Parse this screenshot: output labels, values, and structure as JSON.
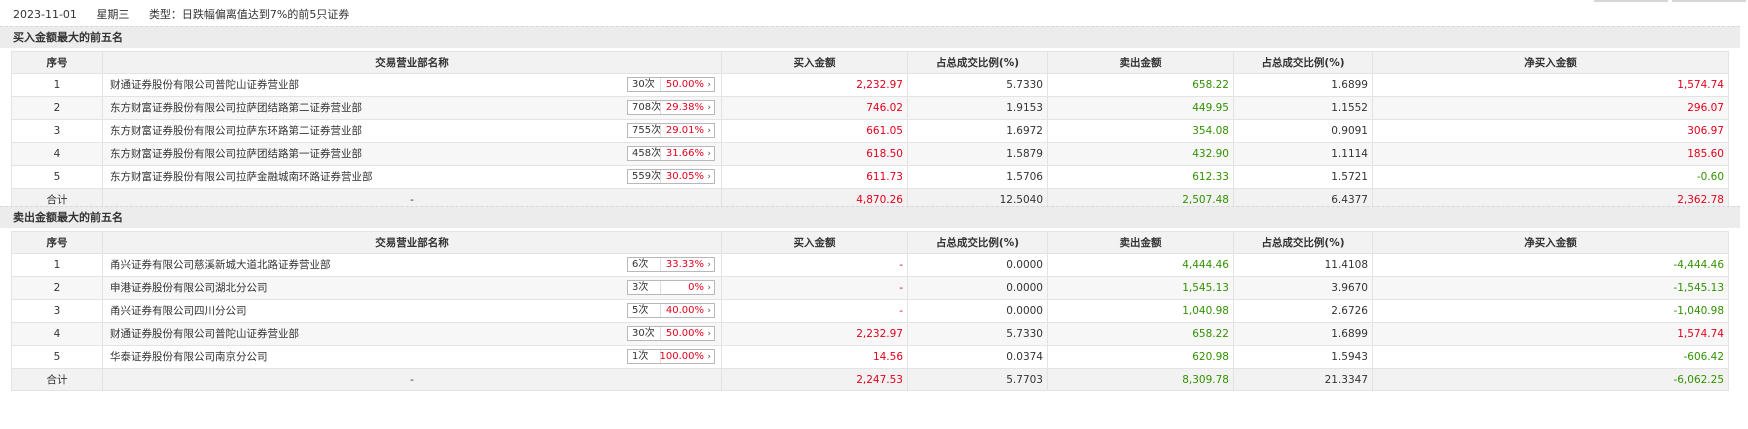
{
  "info": {
    "date": "2023-11-01",
    "weekday": "星期三",
    "type": "类型：日跌幅偏离值达到7%的前5只证券"
  },
  "columns": {
    "rank": "序号",
    "dept": "交易营业部名称",
    "buy": "买入金额",
    "buy_ratio": "占总成交比例(%)",
    "sell": "卖出金额",
    "sell_ratio": "占总成交比例(%)",
    "net": "净买入金额"
  },
  "buy_section": {
    "title": "买入金额最大的前五名",
    "rows": [
      {
        "rank": "1",
        "dept": "财通证券股份有限公司普陀山证券营业部",
        "count": "30次",
        "pct": "50.00%",
        "buy": "2,232.97",
        "buy_ratio": "5.7330",
        "sell": "658.22",
        "sell_ratio": "1.6899",
        "net": "1,574.74"
      },
      {
        "rank": "2",
        "dept": "东方财富证券股份有限公司拉萨团结路第二证券营业部",
        "count": "708次",
        "pct": "29.38%",
        "buy": "746.02",
        "buy_ratio": "1.9153",
        "sell": "449.95",
        "sell_ratio": "1.1552",
        "net": "296.07"
      },
      {
        "rank": "3",
        "dept": "东方财富证券股份有限公司拉萨东环路第二证券营业部",
        "count": "755次",
        "pct": "29.01%",
        "buy": "661.05",
        "buy_ratio": "1.6972",
        "sell": "354.08",
        "sell_ratio": "0.9091",
        "net": "306.97"
      },
      {
        "rank": "4",
        "dept": "东方财富证券股份有限公司拉萨团结路第一证券营业部",
        "count": "458次",
        "pct": "31.66%",
        "buy": "618.50",
        "buy_ratio": "1.5879",
        "sell": "432.90",
        "sell_ratio": "1.1114",
        "net": "185.60"
      },
      {
        "rank": "5",
        "dept": "东方财富证券股份有限公司拉萨金融城南环路证券营业部",
        "count": "559次",
        "pct": "30.05%",
        "buy": "611.73",
        "buy_ratio": "1.5706",
        "sell": "612.33",
        "sell_ratio": "1.5721",
        "net": "-0.60"
      }
    ],
    "total": {
      "label": "合计",
      "dept": "-",
      "buy": "4,870.26",
      "buy_ratio": "12.5040",
      "sell": "2,507.48",
      "sell_ratio": "6.4377",
      "net": "2,362.78"
    }
  },
  "sell_section": {
    "title": "卖出金额最大的前五名",
    "rows": [
      {
        "rank": "1",
        "dept": "甬兴证券有限公司慈溪新城大道北路证券营业部",
        "count": "6次",
        "pct": "33.33%",
        "buy": "-",
        "buy_ratio": "0.0000",
        "sell": "4,444.46",
        "sell_ratio": "11.4108",
        "net": "-4,444.46"
      },
      {
        "rank": "2",
        "dept": "申港证券股份有限公司湖北分公司",
        "count": "3次",
        "pct": "0%",
        "buy": "-",
        "buy_ratio": "0.0000",
        "sell": "1,545.13",
        "sell_ratio": "3.9670",
        "net": "-1,545.13"
      },
      {
        "rank": "3",
        "dept": "甬兴证券有限公司四川分公司",
        "count": "5次",
        "pct": "40.00%",
        "buy": "-",
        "buy_ratio": "0.0000",
        "sell": "1,040.98",
        "sell_ratio": "2.6726",
        "net": "-1,040.98"
      },
      {
        "rank": "4",
        "dept": "财通证券股份有限公司普陀山证券营业部",
        "count": "30次",
        "pct": "50.00%",
        "buy": "2,232.97",
        "buy_ratio": "5.7330",
        "sell": "658.22",
        "sell_ratio": "1.6899",
        "net": "1,574.74"
      },
      {
        "rank": "5",
        "dept": "华泰证券股份有限公司南京分公司",
        "count": "1次",
        "pct": "100.00%",
        "buy": "14.56",
        "buy_ratio": "0.0374",
        "sell": "620.98",
        "sell_ratio": "1.5943",
        "net": "-606.42"
      }
    ],
    "total": {
      "label": "合计",
      "dept": "-",
      "buy": "2,247.53",
      "buy_ratio": "5.7703",
      "sell": "8,309.78",
      "sell_ratio": "21.3347",
      "net": "-6,062.25"
    }
  },
  "colors": {
    "up": "#e4001b",
    "down": "#319200"
  },
  "icons": {
    "row_stat_arrow": "chevron-right-icon"
  }
}
